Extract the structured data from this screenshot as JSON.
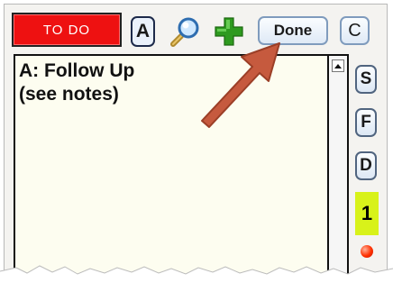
{
  "toolbar": {
    "todo_label": "TO DO",
    "a_label": "A",
    "done_label": "Done",
    "c_label": "C",
    "search_icon": "magnifier-icon",
    "add_icon": "green-plus-icon"
  },
  "notes": {
    "text": "A: Follow Up\n(see notes)"
  },
  "sidebar": {
    "buttons": [
      {
        "label": "S"
      },
      {
        "label": "F"
      },
      {
        "label": "D"
      }
    ],
    "counter": "1",
    "counter_color": "#d8f21a",
    "status_dot_color": "#ff3000"
  },
  "annotation": {
    "arrow_color": "#c65a3e",
    "points_to": "done-button"
  },
  "colors": {
    "todo_bg": "#ee1111",
    "panel_bg": "#f4f3f0",
    "notes_bg": "#fdfdf0"
  }
}
